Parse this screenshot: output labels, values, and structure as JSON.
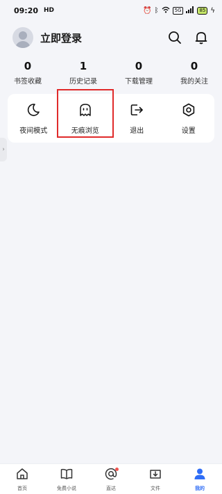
{
  "status_bar": {
    "time": "09:20",
    "carrier": "HD",
    "net": "5G",
    "battery": "85"
  },
  "header": {
    "login_text": "立即登录"
  },
  "stats": [
    {
      "value": "0",
      "label": "书签收藏"
    },
    {
      "value": "1",
      "label": "历史记录"
    },
    {
      "value": "0",
      "label": "下载管理"
    },
    {
      "value": "0",
      "label": "我的关注"
    }
  ],
  "tools": [
    {
      "label": "夜间模式",
      "icon": "moon-icon"
    },
    {
      "label": "无痕浏览",
      "icon": "ghost-icon"
    },
    {
      "label": "退出",
      "icon": "logout-icon"
    },
    {
      "label": "设置",
      "icon": "settings-icon"
    }
  ],
  "bottom_nav": [
    {
      "label": "首页",
      "icon": "home-icon"
    },
    {
      "label": "免费小说",
      "icon": "book-icon"
    },
    {
      "label": "直达",
      "icon": "at-icon"
    },
    {
      "label": "文件",
      "icon": "download-folder-icon"
    },
    {
      "label": "我的",
      "icon": "user-icon"
    }
  ],
  "colors": {
    "accent": "#2f6df6",
    "highlight": "#e02a2a",
    "background": "#f4f5f9"
  }
}
